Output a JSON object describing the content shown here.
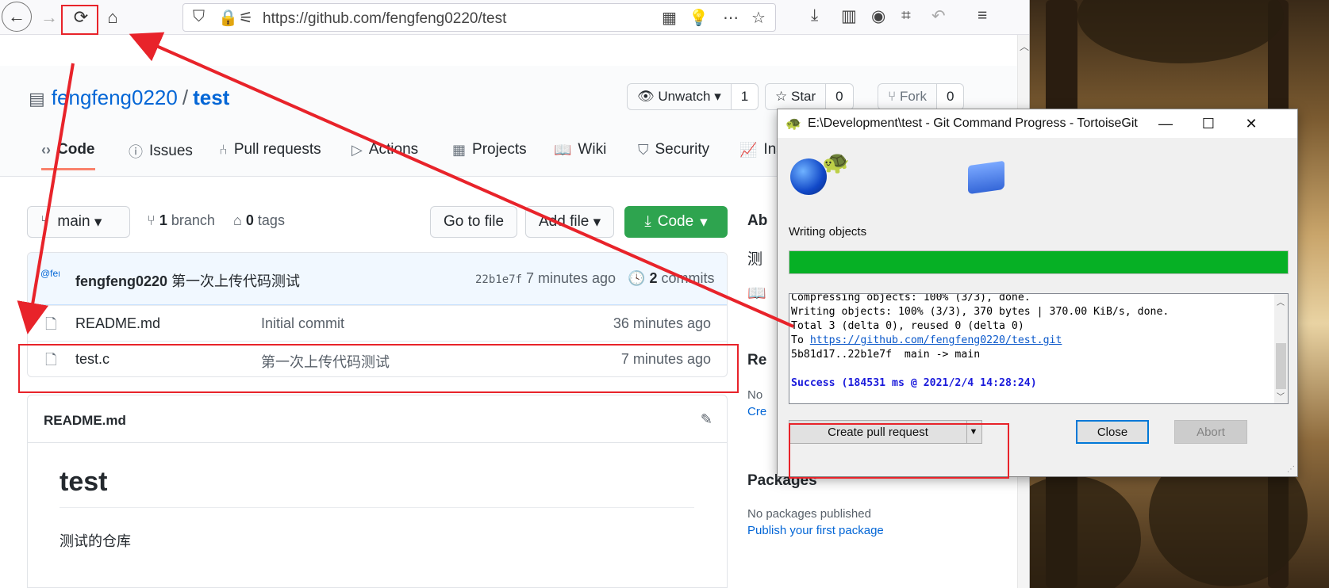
{
  "browser": {
    "url": "https://github.com/fengfeng0220/test"
  },
  "repo": {
    "owner": "fengfeng0220",
    "separator": "/",
    "name": "test",
    "watch_label": "Unwatch",
    "watch_count": "1",
    "star_label": "Star",
    "star_count": "0",
    "fork_label": "Fork",
    "fork_count": "0"
  },
  "nav": {
    "code": "Code",
    "issues": "Issues",
    "pulls": "Pull requests",
    "actions": "Actions",
    "projects": "Projects",
    "wiki": "Wiki",
    "security": "Security",
    "insights": "Ins"
  },
  "branch_bar": {
    "branch": "main",
    "branch_count": "1",
    "branch_word": "branch",
    "tag_count": "0",
    "tag_word": "tags",
    "go_to_file": "Go to file",
    "add_file": "Add file",
    "code_button": "Code"
  },
  "commit": {
    "avatar_text": "@fengfeng",
    "author": "fengfeng0220",
    "message": "第一次上传代码测试",
    "hash": "22b1e7f",
    "time": "7 minutes ago",
    "count": "2",
    "count_word": "commits"
  },
  "files": [
    {
      "name": "README.md",
      "message": "Initial commit",
      "time": "36 minutes ago"
    },
    {
      "name": "test.c",
      "message": "第一次上传代码测试",
      "time": "7 minutes ago"
    }
  ],
  "readme": {
    "header": "README.md",
    "title": "test",
    "body": "测试的仓库"
  },
  "sidebar": {
    "about": "Ab",
    "description": "测",
    "releases": "Re",
    "no_releases": "No",
    "create_release": "Cre",
    "packages": "Packages",
    "no_packages": "No packages published",
    "publish_package": "Publish your first package"
  },
  "dialog": {
    "title": "E:\\Development\\test - Git Command Progress - TortoiseGit",
    "status": "Writing objects",
    "progress": 1.0,
    "log_lines": [
      "Compressing objects: 100% (3/3), done.",
      "Writing objects: 100% (3/3), 370 bytes | 370.00 KiB/s, done.",
      "Total 3 (delta 0), reused 0 (delta 0)"
    ],
    "log_to_prefix": "To ",
    "log_to_url": "https://github.com/fengfeng0220/test.git",
    "log_ref": "5b81d17..22b1e7f  main -> main",
    "log_success": "Success (184531 ms @ 2021/2/4 14:28:24)",
    "create_pr": "Create pull request",
    "close": "Close",
    "abort": "Abort"
  },
  "colors": {
    "annotation_red": "#e8232a",
    "progress_green": "#06b025",
    "github_green": "#2ea44f",
    "link_blue": "#0366d6"
  }
}
